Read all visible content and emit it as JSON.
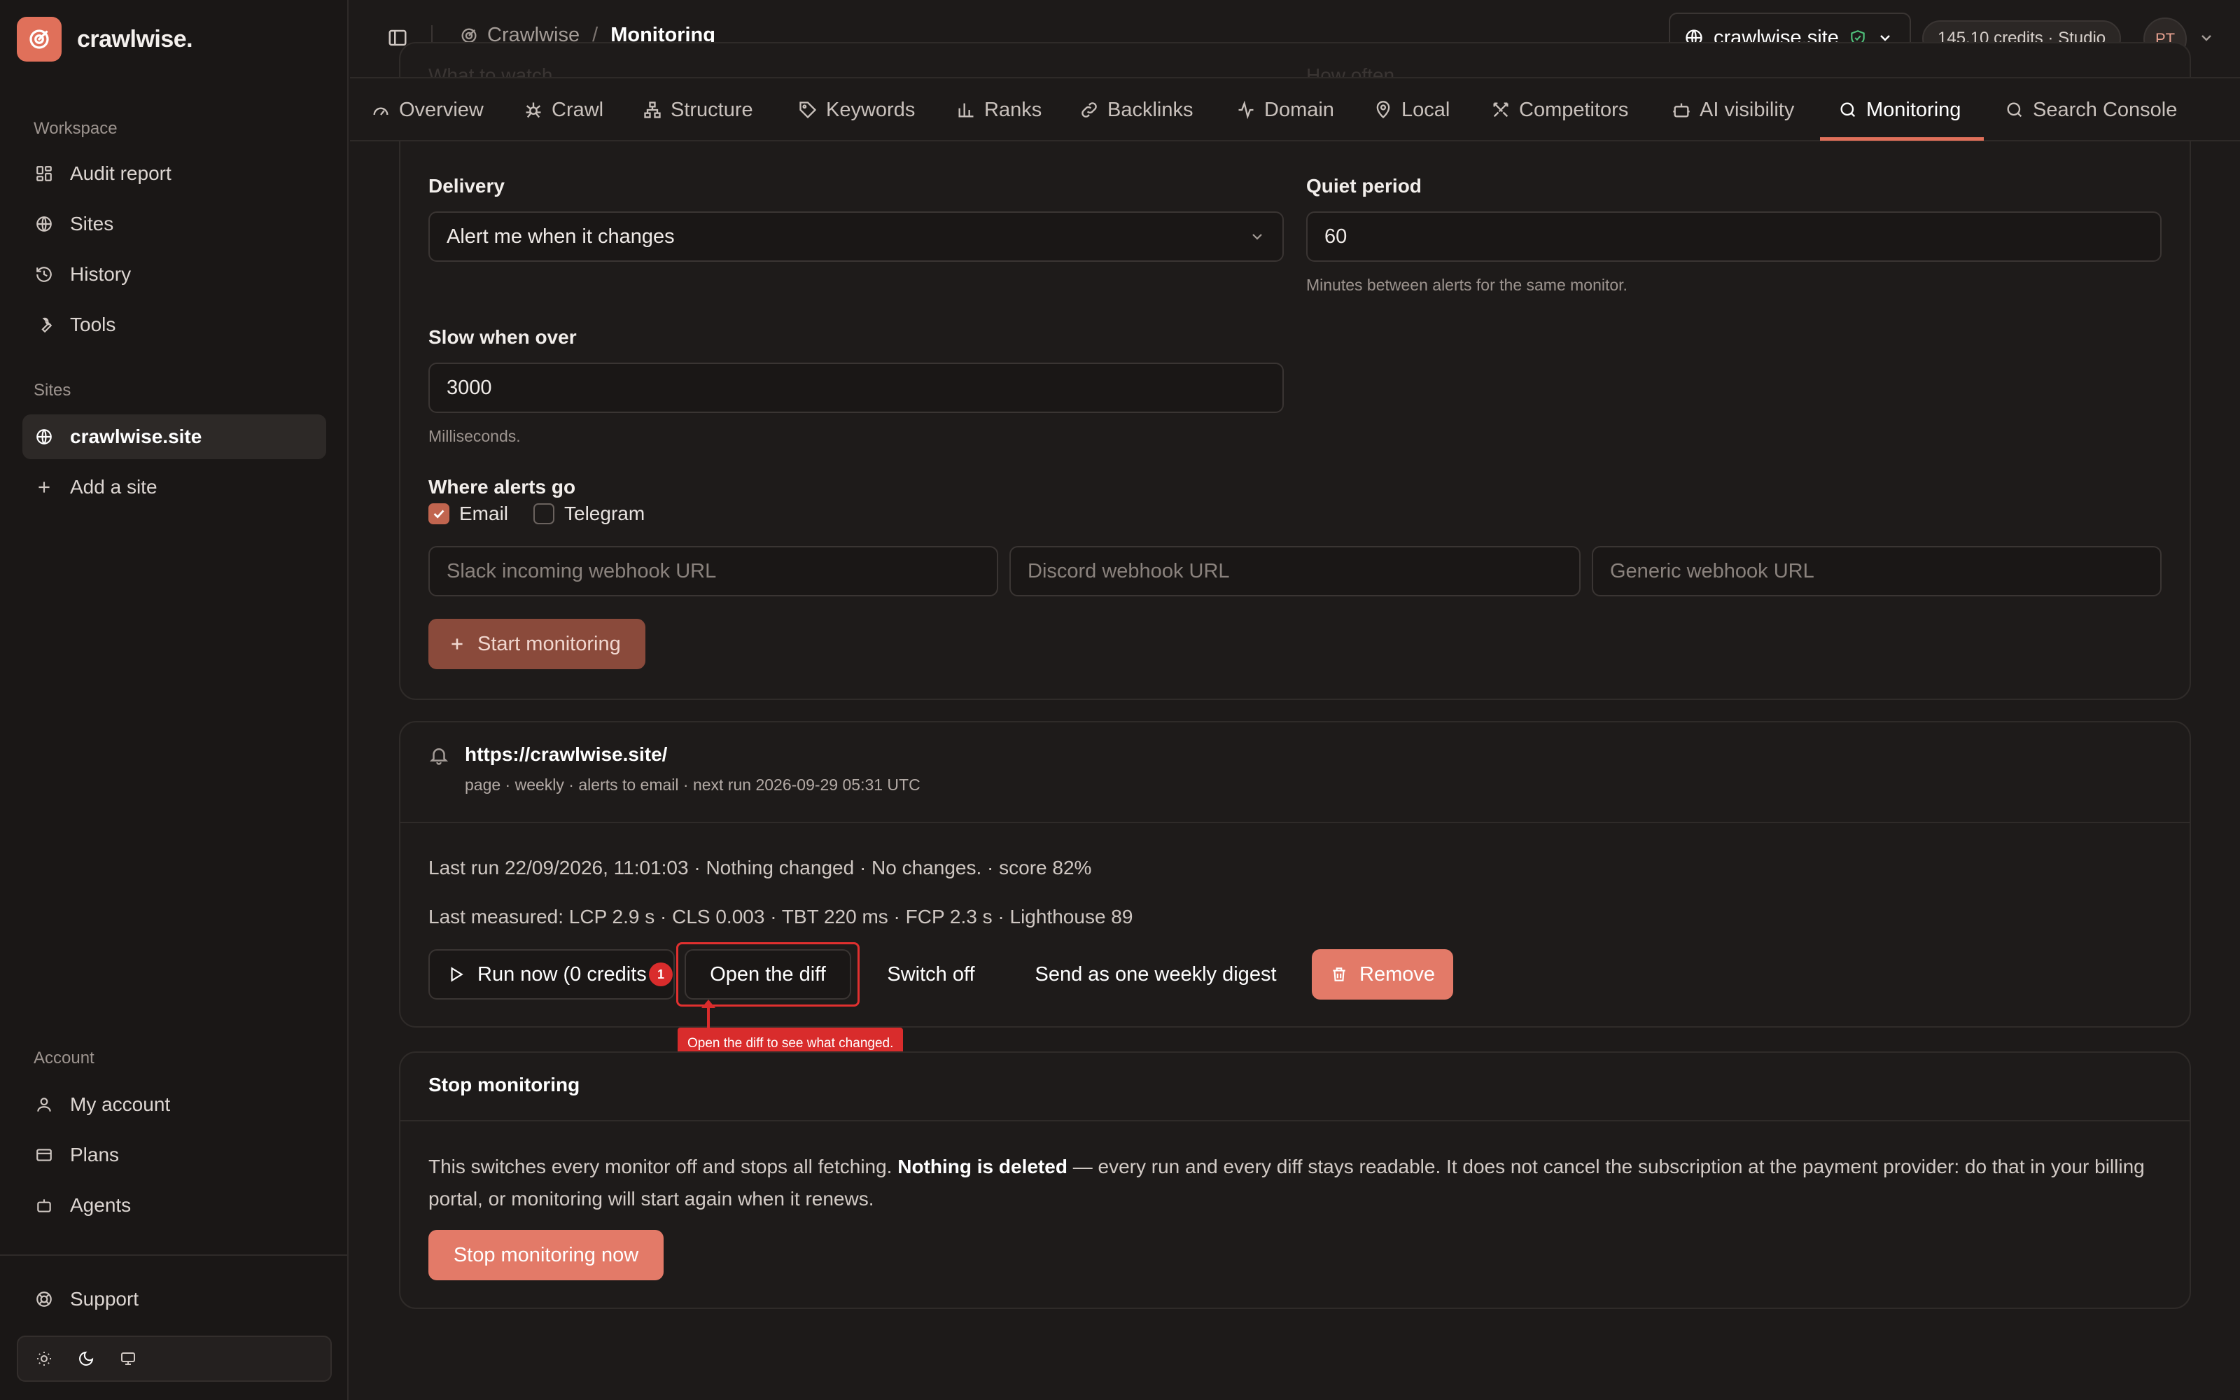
{
  "app": {
    "name": "crawlwise."
  },
  "sidebar": {
    "workspace_label": "Workspace",
    "workspace_items": [
      {
        "label": "Audit report",
        "icon": "grid-icon"
      },
      {
        "label": "Sites",
        "icon": "globe-icon"
      },
      {
        "label": "History",
        "icon": "history-icon"
      },
      {
        "label": "Tools",
        "icon": "wrench-icon"
      }
    ],
    "sites_label": "Sites",
    "site_items": [
      {
        "label": "crawlwise.site",
        "icon": "globe-icon",
        "active": true
      },
      {
        "label": "Add a site",
        "icon": "plus-icon"
      }
    ],
    "account_label": "Account",
    "account_items": [
      {
        "label": "My account",
        "icon": "user-icon"
      },
      {
        "label": "Plans",
        "icon": "card-icon"
      },
      {
        "label": "Agents",
        "icon": "bot-icon"
      }
    ],
    "support_label": "Support"
  },
  "topbar": {
    "breadcrumb_root": "Crawlwise",
    "breadcrumb_current": "Monitoring",
    "site_selector": "crawlwise.site",
    "credits": "145.10 credits · Studio",
    "avatar_initials": "PT"
  },
  "tabs": [
    {
      "label": "Overview",
      "icon": "gauge-icon"
    },
    {
      "label": "Crawl",
      "icon": "spider-icon"
    },
    {
      "label": "Structure",
      "icon": "sitemap-icon"
    },
    {
      "label": "Keywords",
      "icon": "tag-icon"
    },
    {
      "label": "Ranks",
      "icon": "bar-chart-icon"
    },
    {
      "label": "Backlinks",
      "icon": "link-icon"
    },
    {
      "label": "Domain",
      "icon": "activity-icon"
    },
    {
      "label": "Local",
      "icon": "map-pin-icon"
    },
    {
      "label": "Competitors",
      "icon": "swords-icon"
    },
    {
      "label": "AI visibility",
      "icon": "robot-icon"
    },
    {
      "label": "Monitoring",
      "icon": "search-icon",
      "active": true
    },
    {
      "label": "Search Console",
      "icon": "search-icon"
    }
  ],
  "form": {
    "ghost_left": "What to watch",
    "ghost_right": "How often",
    "delivery_label": "Delivery",
    "delivery_value": "Alert me when it changes",
    "quiet_label": "Quiet period",
    "quiet_value": "60",
    "quiet_help": "Minutes between alerts for the same monitor.",
    "slow_label": "Slow when over",
    "slow_value": "3000",
    "slow_help": "Milliseconds.",
    "alerts_label": "Where alerts go",
    "email_label": "Email",
    "email_checked": true,
    "telegram_label": "Telegram",
    "telegram_checked": false,
    "slack_placeholder": "Slack incoming webhook URL",
    "discord_placeholder": "Discord webhook URL",
    "generic_placeholder": "Generic webhook URL",
    "start_button": "Start monitoring"
  },
  "monitor": {
    "url": "https://crawlwise.site/",
    "meta": "page · weekly · alerts to email · next run 2026-09-29 05:31 UTC",
    "last_run": "Last run 22/09/2026, 11:01:03 · Nothing changed · No changes. · score 82%",
    "last_measured": "Last measured: LCP 2.9 s · CLS 0.003 · TBT 220 ms · FCP 2.3 s · Lighthouse 89",
    "run_now_label": "Run now (0 credits",
    "run_badge": "1",
    "open_diff_label": "Open the diff",
    "switch_off_label": "Switch off",
    "digest_label": "Send as one weekly digest",
    "remove_label": "Remove",
    "tooltip": "Open the diff to see what changed."
  },
  "stop": {
    "title": "Stop monitoring",
    "text_before": "This switches every monitor off and stops all fetching. ",
    "text_bold": "Nothing is deleted",
    "text_after": " — every run and every diff stays readable. It does not cancel the subscription at the payment provider: do that in your billing portal, or monitoring will start again when it renews.",
    "button": "Stop monitoring now"
  },
  "colors": {
    "accent": "#e0705a",
    "danger": "#d92c2c",
    "background": "#1d1a19"
  }
}
